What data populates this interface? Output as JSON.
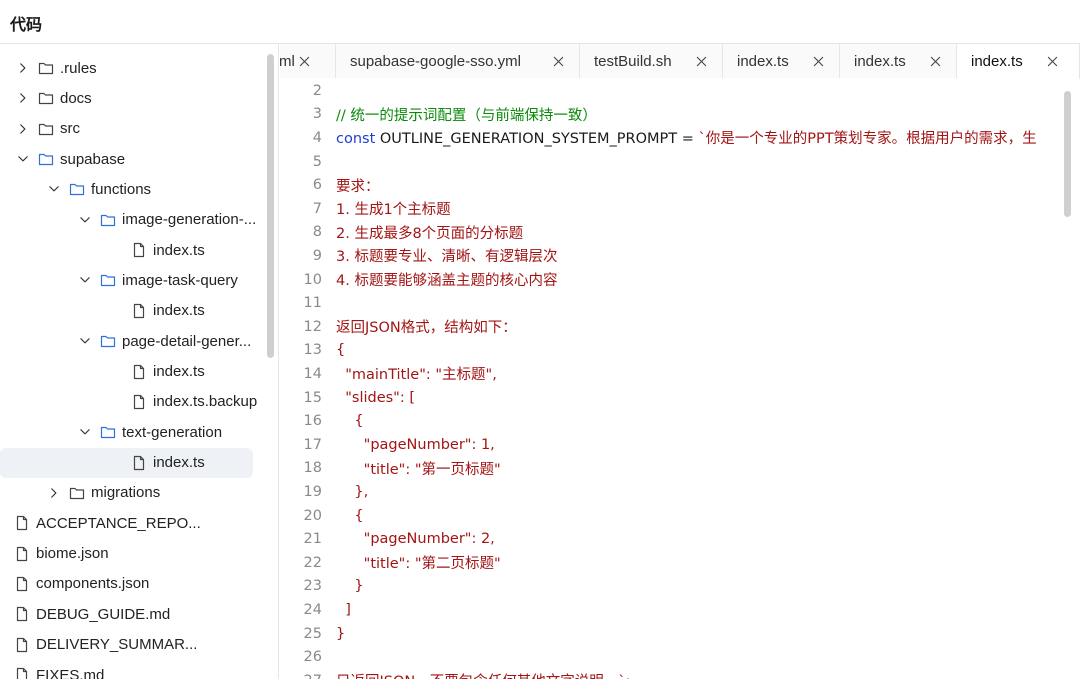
{
  "header": {
    "title": "代码"
  },
  "sidebar": {
    "items": [
      {
        "label": ".rules",
        "kind": "folder",
        "depth": 0,
        "expanded": false
      },
      {
        "label": "docs",
        "kind": "folder",
        "depth": 0,
        "expanded": false
      },
      {
        "label": "src",
        "kind": "folder",
        "depth": 0,
        "expanded": false
      },
      {
        "label": "supabase",
        "kind": "folder",
        "depth": 0,
        "expanded": true
      },
      {
        "label": "functions",
        "kind": "folder",
        "depth": 1,
        "expanded": true
      },
      {
        "label": "image-generation-...",
        "kind": "folder",
        "depth": 2,
        "expanded": true
      },
      {
        "label": "index.ts",
        "kind": "file",
        "depth": 3
      },
      {
        "label": "image-task-query",
        "kind": "folder",
        "depth": 2,
        "expanded": true
      },
      {
        "label": "index.ts",
        "kind": "file",
        "depth": 3
      },
      {
        "label": "page-detail-gener...",
        "kind": "folder",
        "depth": 2,
        "expanded": true
      },
      {
        "label": "index.ts",
        "kind": "file",
        "depth": 3
      },
      {
        "label": "index.ts.backup",
        "kind": "file",
        "depth": 3
      },
      {
        "label": "text-generation",
        "kind": "folder",
        "depth": 2,
        "expanded": true
      },
      {
        "label": "index.ts",
        "kind": "file",
        "depth": 3,
        "selected": true
      },
      {
        "label": "migrations",
        "kind": "folder",
        "depth": 1,
        "expanded": false
      },
      {
        "label": "ACCEPTANCE_REPO...",
        "kind": "file",
        "depth": -1
      },
      {
        "label": "biome.json",
        "kind": "file",
        "depth": -1
      },
      {
        "label": "components.json",
        "kind": "file",
        "depth": -1
      },
      {
        "label": "DEBUG_GUIDE.md",
        "kind": "file",
        "depth": -1
      },
      {
        "label": "DELIVERY_SUMMAR...",
        "kind": "file",
        "depth": -1
      },
      {
        "label": "FIXES.md",
        "kind": "file",
        "depth": -1
      }
    ]
  },
  "tabs": [
    {
      "label": "ml",
      "active": false
    },
    {
      "label": "supabase-google-sso.yml",
      "active": false
    },
    {
      "label": "testBuild.sh",
      "active": false
    },
    {
      "label": "index.ts",
      "active": false
    },
    {
      "label": "index.ts",
      "active": false
    },
    {
      "label": "index.ts",
      "active": true
    }
  ],
  "code": {
    "lines": [
      {
        "n": "2",
        "parts": []
      },
      {
        "n": "3",
        "parts": [
          {
            "t": "// 统一的提示词配置（与前端保持一致）",
            "c": "cmt"
          }
        ]
      },
      {
        "n": "4",
        "parts": [
          {
            "t": "const",
            "c": "kw"
          },
          {
            "t": " OUTLINE_GENERATION_SYSTEM_PROMPT = ",
            "c": "plain"
          },
          {
            "t": "`你是一个专业的PPT策划专家。根据用户的需求，生",
            "c": "str"
          }
        ]
      },
      {
        "n": "5",
        "parts": []
      },
      {
        "n": "6",
        "parts": [
          {
            "t": "要求：",
            "c": "str"
          }
        ]
      },
      {
        "n": "7",
        "parts": [
          {
            "t": "1. 生成1个主标题",
            "c": "str"
          }
        ]
      },
      {
        "n": "8",
        "parts": [
          {
            "t": "2. 生成最多8个页面的分标题",
            "c": "str"
          }
        ]
      },
      {
        "n": "9",
        "parts": [
          {
            "t": "3. 标题要专业、清晰、有逻辑层次",
            "c": "str"
          }
        ]
      },
      {
        "n": "10",
        "parts": [
          {
            "t": "4. 标题要能够涵盖主题的核心内容",
            "c": "str"
          }
        ]
      },
      {
        "n": "11",
        "parts": []
      },
      {
        "n": "12",
        "parts": [
          {
            "t": "返回JSON格式，结构如下：",
            "c": "str"
          }
        ]
      },
      {
        "n": "13",
        "parts": [
          {
            "t": "{",
            "c": "str"
          }
        ]
      },
      {
        "n": "14",
        "parts": [
          {
            "t": "  \"mainTitle\": \"主标题\",",
            "c": "str"
          }
        ]
      },
      {
        "n": "15",
        "parts": [
          {
            "t": "  \"slides\": [",
            "c": "str"
          }
        ]
      },
      {
        "n": "16",
        "parts": [
          {
            "t": "    {",
            "c": "str"
          }
        ]
      },
      {
        "n": "17",
        "parts": [
          {
            "t": "      \"pageNumber\": 1,",
            "c": "str"
          }
        ]
      },
      {
        "n": "18",
        "parts": [
          {
            "t": "      \"title\": \"第一页标题\"",
            "c": "str"
          }
        ]
      },
      {
        "n": "19",
        "parts": [
          {
            "t": "    },",
            "c": "str"
          }
        ]
      },
      {
        "n": "20",
        "parts": [
          {
            "t": "    {",
            "c": "str"
          }
        ]
      },
      {
        "n": "21",
        "parts": [
          {
            "t": "      \"pageNumber\": 2,",
            "c": "str"
          }
        ]
      },
      {
        "n": "22",
        "parts": [
          {
            "t": "      \"title\": \"第二页标题\"",
            "c": "str"
          }
        ]
      },
      {
        "n": "23",
        "parts": [
          {
            "t": "    }",
            "c": "str"
          }
        ]
      },
      {
        "n": "24",
        "parts": [
          {
            "t": "  ]",
            "c": "str"
          }
        ]
      },
      {
        "n": "25",
        "parts": [
          {
            "t": "}",
            "c": "str"
          }
        ]
      },
      {
        "n": "26",
        "parts": []
      },
      {
        "n": "27",
        "parts": [
          {
            "t": "只返回JSON，不要包含任何其他文字说明。`;",
            "c": "str"
          }
        ]
      }
    ]
  },
  "colors": {
    "accent": "#2f6fe0",
    "comment": "#0a8a0a",
    "keyword": "#1f3fd0",
    "string": "#a31515"
  }
}
